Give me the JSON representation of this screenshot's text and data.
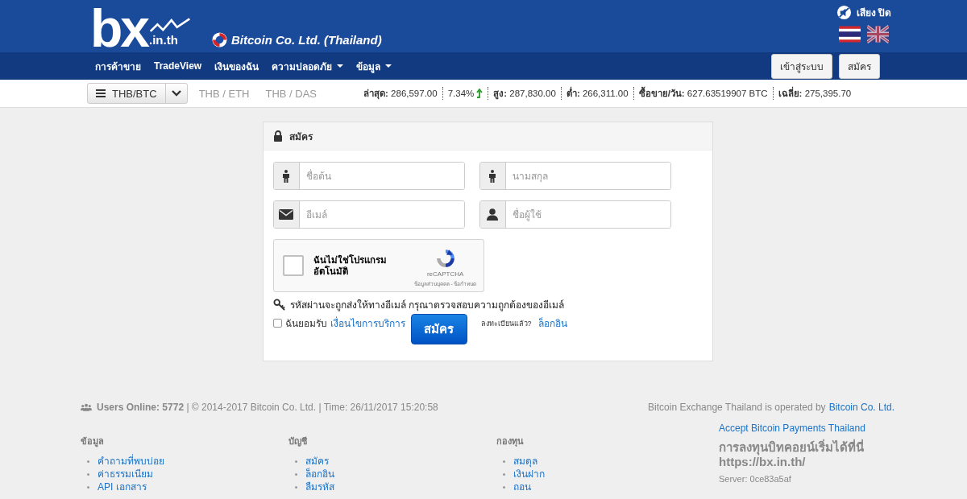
{
  "header": {
    "logo": {
      "main": "bx",
      "domain": ".in.th"
    },
    "company": "Bitcoin Co. Ltd. (Thailand)",
    "sound": "เสียง ปิด"
  },
  "nav": {
    "items": [
      {
        "label": "การค้าขาย",
        "dropdown": false
      },
      {
        "label": "TradeView",
        "dropdown": false
      },
      {
        "label": "เงินของฉัน",
        "dropdown": false
      },
      {
        "label": "ความปลอดภัย",
        "dropdown": true
      },
      {
        "label": "ข้อมูล",
        "dropdown": true
      }
    ],
    "buttons": [
      "เข้าสู่ระบบ",
      "สมัคร"
    ]
  },
  "pairs": [
    {
      "label": "THB/BTC",
      "selected": true
    },
    {
      "label": "THB / ETH",
      "selected": false
    },
    {
      "label": "THB / DAS",
      "selected": false
    }
  ],
  "ticker": [
    {
      "kind": "stat",
      "label": "ล่าสุด:",
      "value": "286,597.00"
    },
    {
      "kind": "change",
      "value": "7.34%"
    },
    {
      "kind": "stat",
      "label": "สูง:",
      "value": "287,830.00"
    },
    {
      "kind": "stat",
      "label": "ต่ำ:",
      "value": "266,311.00"
    },
    {
      "kind": "stat",
      "label": "ซื้อขาย/วัน:",
      "value": "627.63519907 BTC"
    },
    {
      "kind": "stat",
      "label": "เฉลี่ย:",
      "value": "275,395.70"
    }
  ],
  "form": {
    "title": "สมัคร",
    "fields": [
      {
        "kind": "person",
        "placeholder": "ชื่อต้น"
      },
      {
        "kind": "person",
        "placeholder": "นามสกุล"
      },
      {
        "kind": "email",
        "placeholder": "อีเมล์"
      },
      {
        "kind": "user",
        "placeholder": "ชื่อผู้ใช้"
      }
    ],
    "captcha": {
      "checked": false,
      "lines": [
        "ฉันไม่ใช่โปรแกรม",
        "อัตโนมัติ"
      ],
      "brand": "reCAPTCHA",
      "links": "ข้อมูลส่วนบุคคล - ข้อกำหนด"
    },
    "notice": "รหัสผ่านจะถูกส่งให้ทางอีเมล์ กรุณาตรวจสอบความถูกต้องของอีเมล์",
    "terms": {
      "checked": false,
      "prefix": "ฉันยอมรับ",
      "link": "เงื่อนไขการบริการ"
    },
    "submit": "สมัคร",
    "registered": "ลงทะเบียนแล้ว?",
    "login": "ล็อกอิน"
  },
  "footer": {
    "status": "**Users Online: 5772** | © 2014-2017 Bitcoin Co. Ltd. | Time: 26/11/2017 15:20:58",
    "operated": "Bitcoin Exchange Thailand is operated by",
    "operator": "Bitcoin Co. Ltd.",
    "columns": [
      {
        "title": "ข้อมูล",
        "links": [
          "คำถามที่พบบ่อย",
          "ค่าธรรมเนียม",
          "API เอกสาร"
        ]
      },
      {
        "title": "บัญชี",
        "links": [
          "สมัคร",
          "ล็อกอิน",
          "ลืมรหัส"
        ]
      },
      {
        "title": "กองทุน",
        "links": [
          "สมดุล",
          "เงินฝาก",
          "ถอน"
        ]
      }
    ],
    "accept": "Accept Bitcoin Payments Thailand",
    "slogan": "การลงทุนบิทคอยน์เริ่มได้ที่นี่ https://bx.in.th/",
    "server": "Server: 0ce83a5af"
  }
}
